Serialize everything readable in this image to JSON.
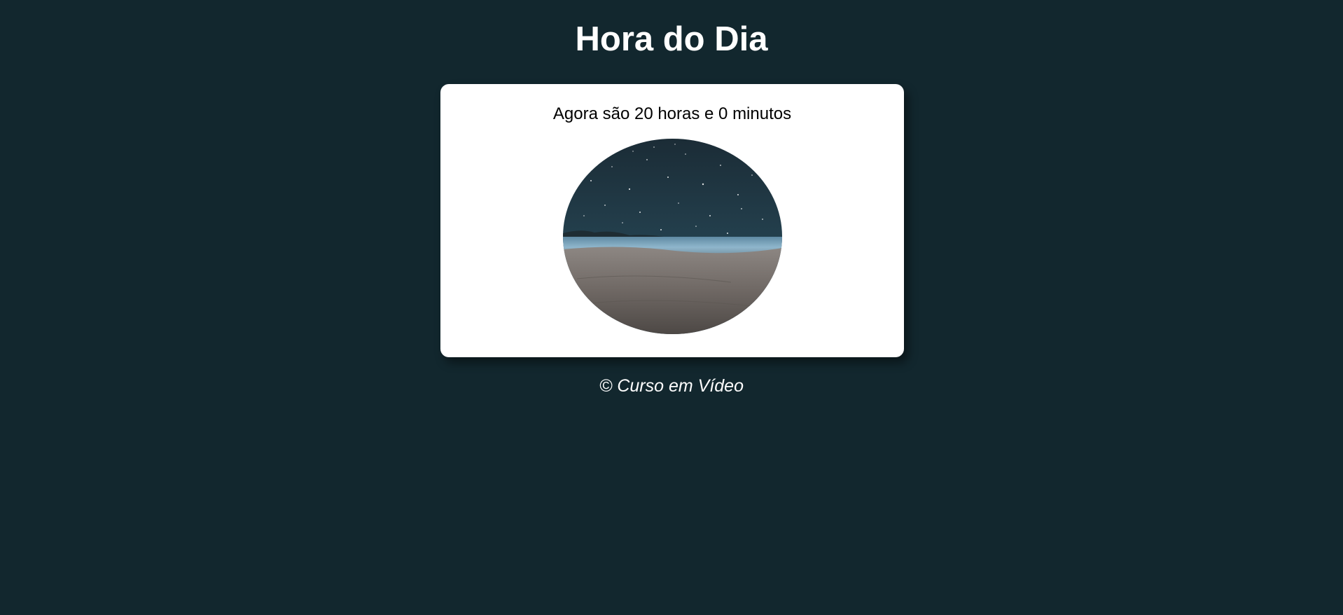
{
  "page": {
    "title": "Hora do Dia",
    "background_color": "#12272e"
  },
  "card": {
    "time_message": "Agora são 20 horas e 0 minutos",
    "image": {
      "icon": "night-beach-photo"
    }
  },
  "footer": {
    "text": "© Curso em Vídeo"
  }
}
